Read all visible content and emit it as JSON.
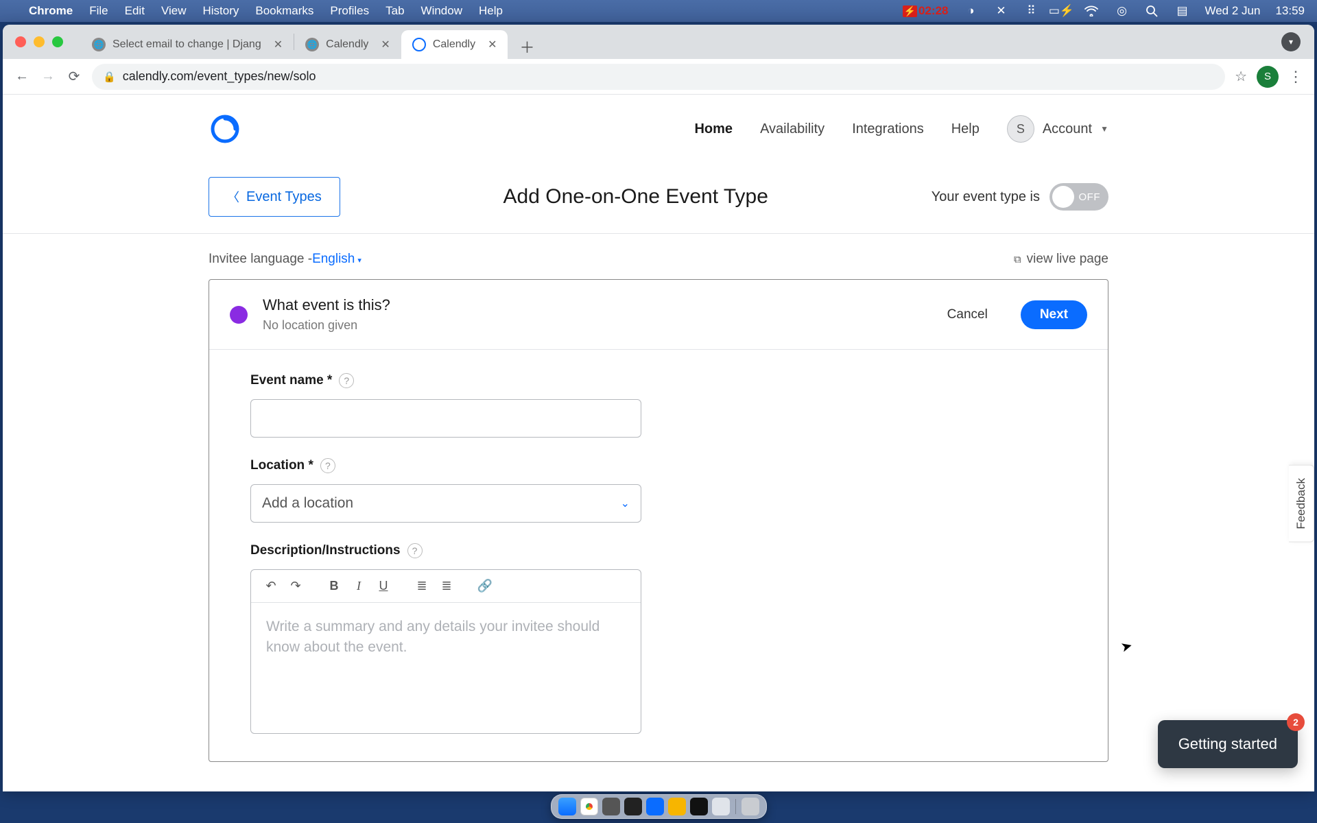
{
  "macmenu": {
    "app": "Chrome",
    "items": [
      "File",
      "Edit",
      "View",
      "History",
      "Bookmarks",
      "Profiles",
      "Tab",
      "Window",
      "Help"
    ],
    "timer": "02:28",
    "date": "Wed 2 Jun",
    "time": "13:59"
  },
  "browser": {
    "tabs": [
      {
        "title": "Select email to change | Djang",
        "active": false,
        "favicon": "globe"
      },
      {
        "title": "Calendly",
        "active": false,
        "favicon": "globe"
      },
      {
        "title": "Calendly",
        "active": true,
        "favicon": "calendly"
      }
    ],
    "url": "calendly.com/event_types/new/solo",
    "avatar_letter": "S"
  },
  "app": {
    "nav": {
      "home": "Home",
      "availability": "Availability",
      "integrations": "Integrations",
      "help": "Help",
      "account": "Account",
      "avatar_letter": "S"
    },
    "back_button": "Event Types",
    "page_title": "Add One-on-One Event Type",
    "toggle_label": "Your event type is",
    "toggle_state": "OFF",
    "invitee_lang_label": "Invitee language - ",
    "invitee_lang_value": "English",
    "view_live": "view live page",
    "card": {
      "title": "What event is this?",
      "subtitle": "No location given",
      "cancel": "Cancel",
      "next": "Next",
      "color": "#8a2be2"
    },
    "form": {
      "event_name_label": "Event name *",
      "event_name_value": "",
      "location_label": "Location *",
      "location_placeholder": "Add a location",
      "description_label": "Description/Instructions",
      "description_placeholder": "Write a summary and any details your invitee should know about the event."
    },
    "rte_tools": {
      "undo": "↶",
      "redo": "↷",
      "bold": "B",
      "italic": "I",
      "underline": "U",
      "ul": "≣",
      "ol": "≣",
      "link": "🔗"
    },
    "feedback": "Feedback",
    "getting_started": "Getting started",
    "getting_started_badge": "2"
  },
  "dock": [
    "finder",
    "chrome",
    "sys",
    "obs",
    "code",
    "notes",
    "term",
    "mail",
    "trash"
  ]
}
